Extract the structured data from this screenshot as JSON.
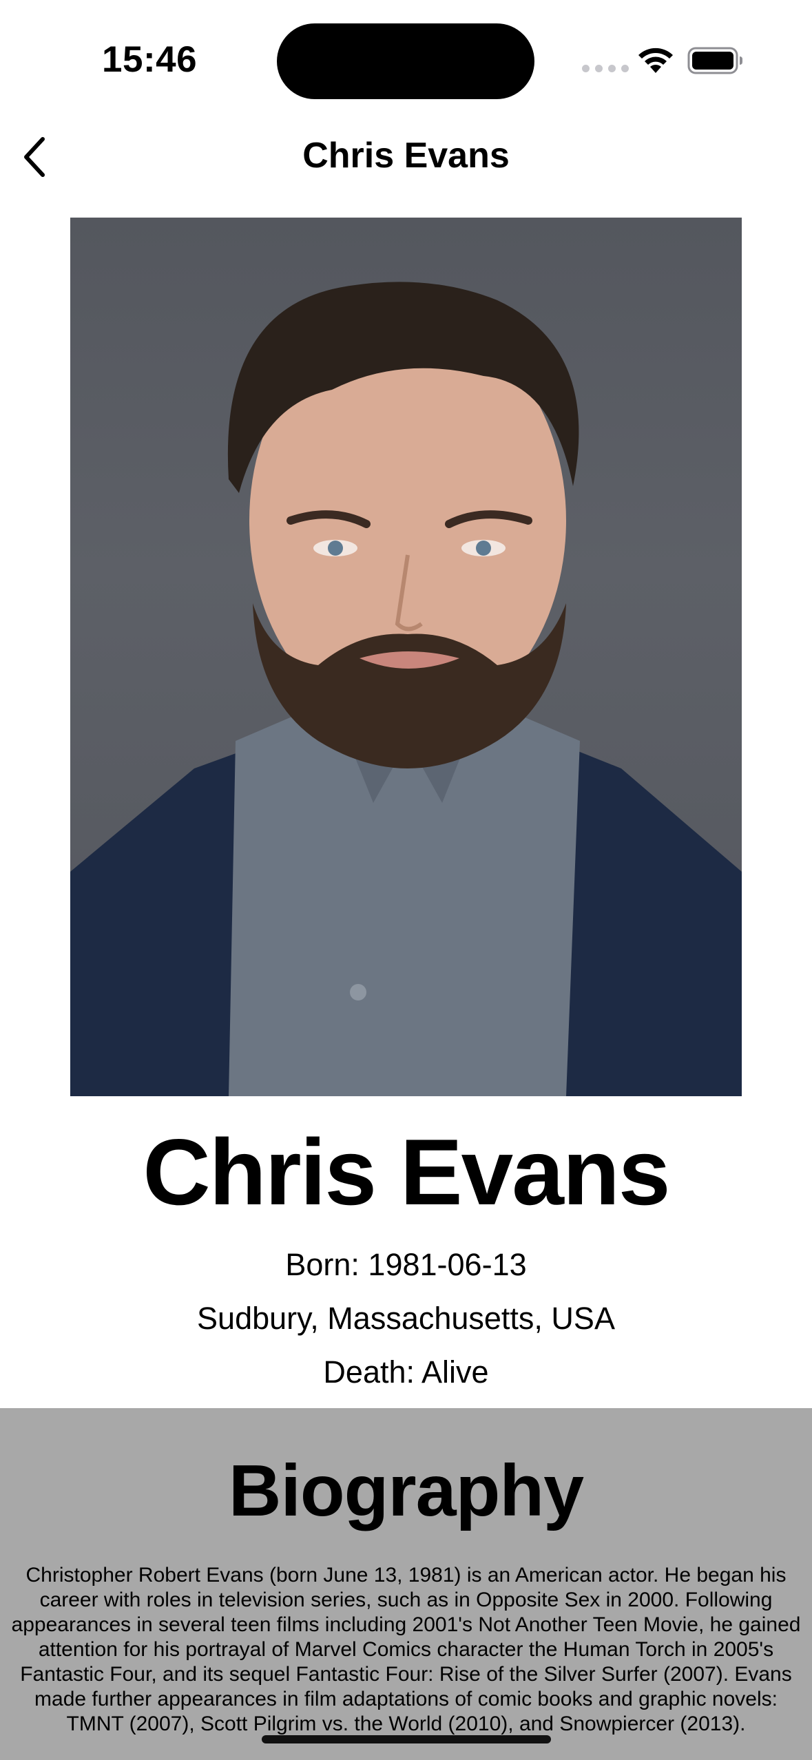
{
  "status_bar": {
    "time": "15:46"
  },
  "nav": {
    "title": "Chris Evans",
    "back_icon": "chevron-left-icon"
  },
  "person": {
    "name": "Chris Evans",
    "born": "Born: 1981-06-13",
    "birthplace": "Sudbury, Massachusetts, USA",
    "death": "Death: Alive"
  },
  "biography": {
    "title": "Biography",
    "text": "Christopher Robert Evans (born June 13, 1981) is an American actor. He began his career with roles in television series, such as in Opposite Sex in 2000. Following appearances in several teen films including 2001's Not Another Teen Movie, he gained attention for his portrayal of Marvel Comics character the Human Torch in 2005's Fantastic Four, and its sequel Fantastic Four: Rise of the Silver Surfer (2007). Evans made further appearances in film adaptations of comic books and graphic novels: TMNT (2007), Scott Pilgrim vs. the World (2010), and Snowpiercer (2013)."
  },
  "colors": {
    "bio_background": "#a8a8a8",
    "photo_background": "#5a5d64",
    "text": "#000000"
  }
}
